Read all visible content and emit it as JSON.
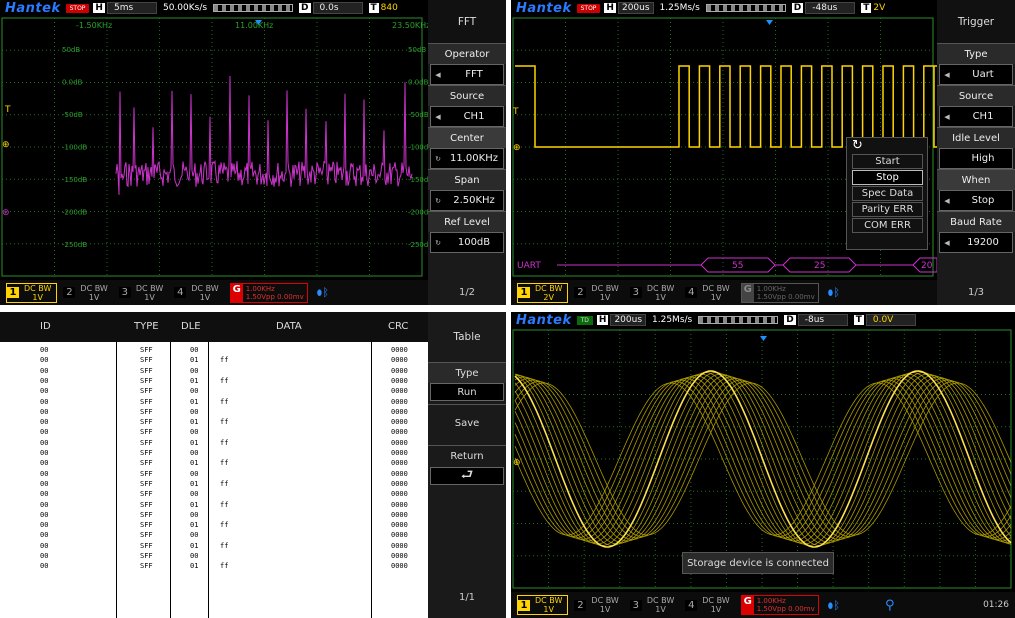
{
  "fft_panel": {
    "logo": "Hantek",
    "status": "STOP",
    "h_label": "H",
    "timebase": "5ms",
    "sample_rate": "50.00Ks/s",
    "d_label": "D",
    "delay": "0.0s",
    "t_label": "T",
    "trigger": "840",
    "freq_left": "-1.50KHz",
    "freq_center": "11.00KHz",
    "freq_right": "23.50KHz",
    "db_labels": [
      "50dB",
      "0.0dB",
      "-50dB",
      "-100dB",
      "-150dB",
      "-200dB",
      "-250dB"
    ],
    "menu": {
      "header": "FFT",
      "operator_title": "Operator",
      "operator_value": "FFT",
      "source_title": "Source",
      "source_value": "CH1",
      "center_title": "Center",
      "center_value": "11.00KHz",
      "span_title": "Span",
      "span_value": "2.50KHz",
      "reflevel_title": "Ref Level",
      "reflevel_value": "100dB",
      "page": "1/2"
    }
  },
  "uart_panel": {
    "logo": "Hantek",
    "status": "STOP",
    "h_label": "H",
    "timebase": "200us",
    "sample_rate": "1.25Ms/s",
    "d_label": "D",
    "delay": "-48us",
    "t_label": "T",
    "trigger": "2V",
    "bus_label": "UART",
    "bus_values": [
      "55",
      "25",
      "20"
    ],
    "popup": [
      "Start",
      "Stop",
      "Spec Data",
      "Parity ERR",
      "COM ERR"
    ],
    "menu": {
      "header": "Trigger",
      "type_title": "Type",
      "type_value": "Uart",
      "source_title": "Source",
      "source_value": "CH1",
      "idle_title": "Idle Level",
      "idle_value": "High",
      "when_title": "When",
      "when_value": "Stop",
      "baud_title": "Baud Rate",
      "baud_value": "19200",
      "page": "1/3"
    }
  },
  "table_panel": {
    "headers": [
      "ID",
      "TYPE",
      "DLE",
      "DATA",
      "CRC"
    ],
    "rows": [
      [
        "00",
        "SFF",
        "00",
        "",
        "0000"
      ],
      [
        "00",
        "SFF",
        "01",
        "ff",
        "0000"
      ],
      [
        "00",
        "SFF",
        "00",
        "",
        "0000"
      ],
      [
        "00",
        "SFF",
        "01",
        "ff",
        "0000"
      ],
      [
        "00",
        "SFF",
        "00",
        "",
        "0000"
      ],
      [
        "00",
        "SFF",
        "01",
        "ff",
        "0000"
      ],
      [
        "00",
        "SFF",
        "00",
        "",
        "0000"
      ],
      [
        "00",
        "SFF",
        "01",
        "ff",
        "0000"
      ],
      [
        "00",
        "SFF",
        "00",
        "",
        "0000"
      ],
      [
        "00",
        "SFF",
        "01",
        "ff",
        "0000"
      ],
      [
        "00",
        "SFF",
        "00",
        "",
        "0000"
      ],
      [
        "00",
        "SFF",
        "01",
        "ff",
        "0000"
      ],
      [
        "00",
        "SFF",
        "00",
        "",
        "0000"
      ],
      [
        "00",
        "SFF",
        "01",
        "ff",
        "0000"
      ],
      [
        "00",
        "SFF",
        "00",
        "",
        "0000"
      ],
      [
        "00",
        "SFF",
        "01",
        "ff",
        "0000"
      ],
      [
        "00",
        "SFF",
        "00",
        "",
        "0000"
      ],
      [
        "00",
        "SFF",
        "01",
        "ff",
        "0000"
      ],
      [
        "00",
        "SFF",
        "00",
        "",
        "0000"
      ],
      [
        "00",
        "SFF",
        "01",
        "ff",
        "0000"
      ],
      [
        "00",
        "SFF",
        "00",
        "",
        "0000"
      ],
      [
        "00",
        "SFF",
        "01",
        "ff",
        "0000"
      ]
    ],
    "menu": {
      "header": "Table",
      "type_title": "Type",
      "type_value": "Run",
      "save": "Save",
      "return": "Return",
      "page": "1/1"
    }
  },
  "sine_panel": {
    "logo": "Hantek",
    "status": "TD",
    "h_label": "H",
    "timebase": "200us",
    "sample_rate": "1.25Ms/s",
    "d_label": "D",
    "delay": "-8us",
    "t_label": "T",
    "trigger": "0.0V",
    "toast": "Storage device is connected",
    "clock": "01:26"
  },
  "bottom_bar": {
    "ch1": [
      "DC",
      "BW",
      "1V"
    ],
    "ch2": [
      "DC",
      "BW",
      "1V"
    ],
    "ch3": [
      "DC",
      "BW",
      "1V"
    ],
    "ch4": [
      "DC",
      "BW",
      "1V"
    ],
    "ch1_alt": [
      "DC",
      "BW",
      "2V"
    ],
    "gen_freq": "1.00KHz",
    "gen_amp": "1.50Vpp 0.00mv"
  },
  "colors": {
    "ch1": "#ffd400",
    "math": "#cc33cc",
    "grid": "#1f6e1f",
    "logo": "#2a7bff"
  }
}
